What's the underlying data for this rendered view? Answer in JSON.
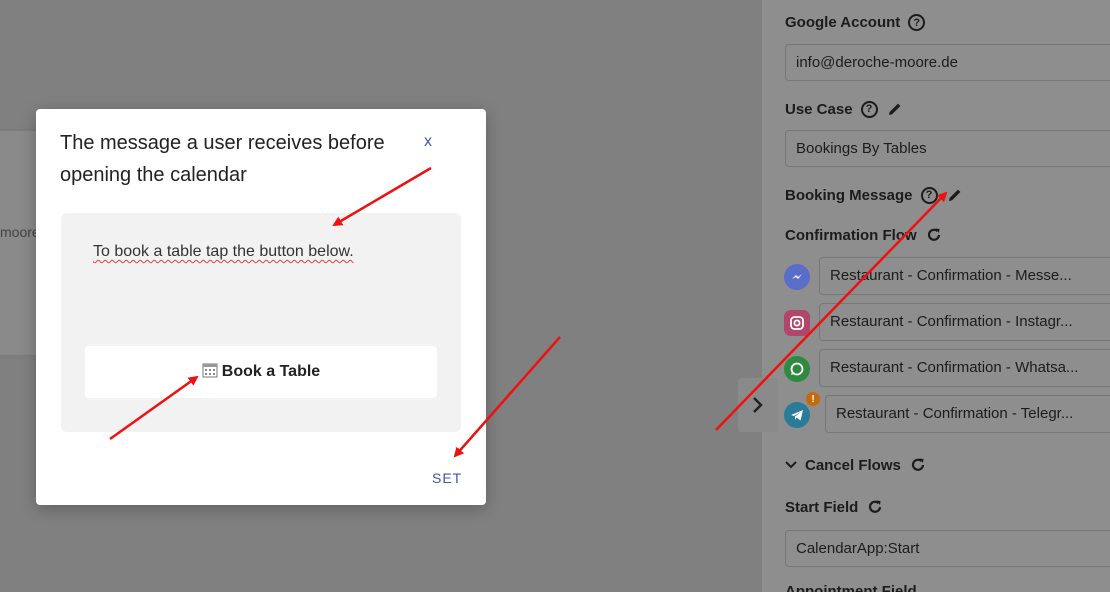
{
  "background": {
    "card_text": "moore.de"
  },
  "panel": {
    "google_account": {
      "label": "Google Account",
      "value": "info@deroche-moore.de"
    },
    "use_case": {
      "label": "Use Case",
      "value": "Bookings By Tables"
    },
    "booking_message": {
      "label": "Booking Message"
    },
    "confirmation_flow": {
      "label": "Confirmation Flow",
      "flows": [
        {
          "icon": "messenger-icon",
          "value": "Restaurant - Confirmation - Messe..."
        },
        {
          "icon": "instagram-icon",
          "value": "Restaurant - Confirmation - Instagr..."
        },
        {
          "icon": "whatsapp-icon",
          "value": "Restaurant - Confirmation - Whatsa..."
        },
        {
          "icon": "telegram-icon",
          "value": "Restaurant - Confirmation - Telegr...",
          "badge": "!"
        }
      ]
    },
    "cancel_flows": {
      "label": "Cancel Flows"
    },
    "start_field": {
      "label": "Start Field",
      "value": "CalendarApp:Start"
    },
    "appointment_field": {
      "label": "Appointment Field"
    }
  },
  "modal": {
    "title": "The message a user receives before opening the calendar",
    "close_label": "x",
    "message_text": "To book a table tap the button below.",
    "button_label": "Book a Table",
    "set_label": "SET"
  },
  "colors": {
    "accent": "#3f51b5",
    "annotation_arrow": "#ee1111",
    "warning_badge": "#c66a10"
  }
}
